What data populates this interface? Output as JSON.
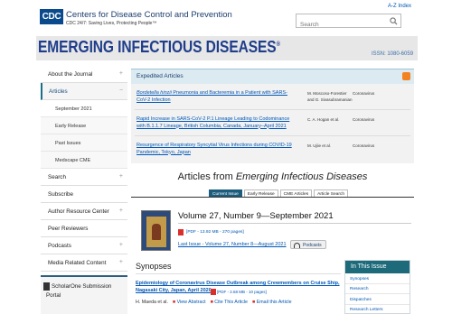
{
  "header": {
    "logo_text": "CDC",
    "org_name": "Centers for Disease Control and Prevention",
    "tagline": "CDC 24/7: Saving Lives, Protecting People™",
    "az_index": "A-Z Index",
    "search_placeholder": "Search"
  },
  "banner": {
    "title": "EMERGING INFECTIOUS DISEASES",
    "registered": "®",
    "issn": "ISSN: 1080-6059"
  },
  "sidebar": {
    "items": [
      {
        "label": "About the Journal",
        "toggle": "+"
      },
      {
        "label": "Articles",
        "toggle": "−"
      },
      {
        "label": "Search",
        "toggle": "+"
      },
      {
        "label": "Subscribe",
        "toggle": ""
      },
      {
        "label": "Author Resource Center",
        "toggle": "+"
      },
      {
        "label": "Peer Reviewers",
        "toggle": ""
      },
      {
        "label": "Podcasts",
        "toggle": "+"
      },
      {
        "label": "Media Related Content",
        "toggle": "+"
      }
    ],
    "subitems": [
      "September 2021",
      "Early Release",
      "Past Issues",
      "Medscape CME"
    ],
    "scholarone": "ScholarOne Submission Portal"
  },
  "expedited": {
    "header": "Expedited Articles",
    "rows": [
      {
        "title_italic": "Bordetella hinzii",
        "title": " Pneumonia and Bacteremia in a Patient with SARS-CoV-2 Infection",
        "authors": "M. Moscoso-Forestier and G. Sivasubramanian",
        "category": "Coronavirus"
      },
      {
        "title_italic": "",
        "title": "Rapid Increase in SARS-CoV-2 P.1 Lineage Leading to Codominance with B.1.1.7 Lineage, British Columbia, Canada, January–April 2021",
        "authors": "C. A. Hogan et al.",
        "category": "Coronavirus"
      },
      {
        "title_italic": "",
        "title": "Resurgence of Respiratory Syncytial Virus Infections during COVID-19 Pandemic, Tokyo, Japan",
        "authors": "M. Ujiie et al.",
        "category": "Coronavirus"
      }
    ]
  },
  "articles": {
    "heading_prefix": "Articles from ",
    "heading_italic": "Emerging Infectious Diseases",
    "tabs": [
      "Current Issue",
      "Early Release",
      "CME Articles",
      "Article Search"
    ]
  },
  "issue": {
    "title": "Volume 27, Number 9—September 2021",
    "pdf": "[PDF - 13.92 MB - 270 pages]",
    "last_issue": "Last Issue - Volume 27, Number 8—August 2021",
    "podcasts": "Podcasts"
  },
  "synopses": {
    "heading": "Synopses",
    "title": "Epidemiology of Coronavirus Disease Outbreak among Crewmembers on Cruise Ship, Nagasaki City, Japan, April 2020",
    "pdf": "[PDF - 2.68 MB - 10 pages]",
    "authors": "H. Maeda et al.",
    "view_abstract": "View Abstract",
    "cite": "Cite This Article",
    "email": "Email this Article"
  },
  "in_this_issue": {
    "heading": "In This Issue",
    "items": [
      "Synopses",
      "Research",
      "Dispatches",
      "Research Letters"
    ]
  }
}
